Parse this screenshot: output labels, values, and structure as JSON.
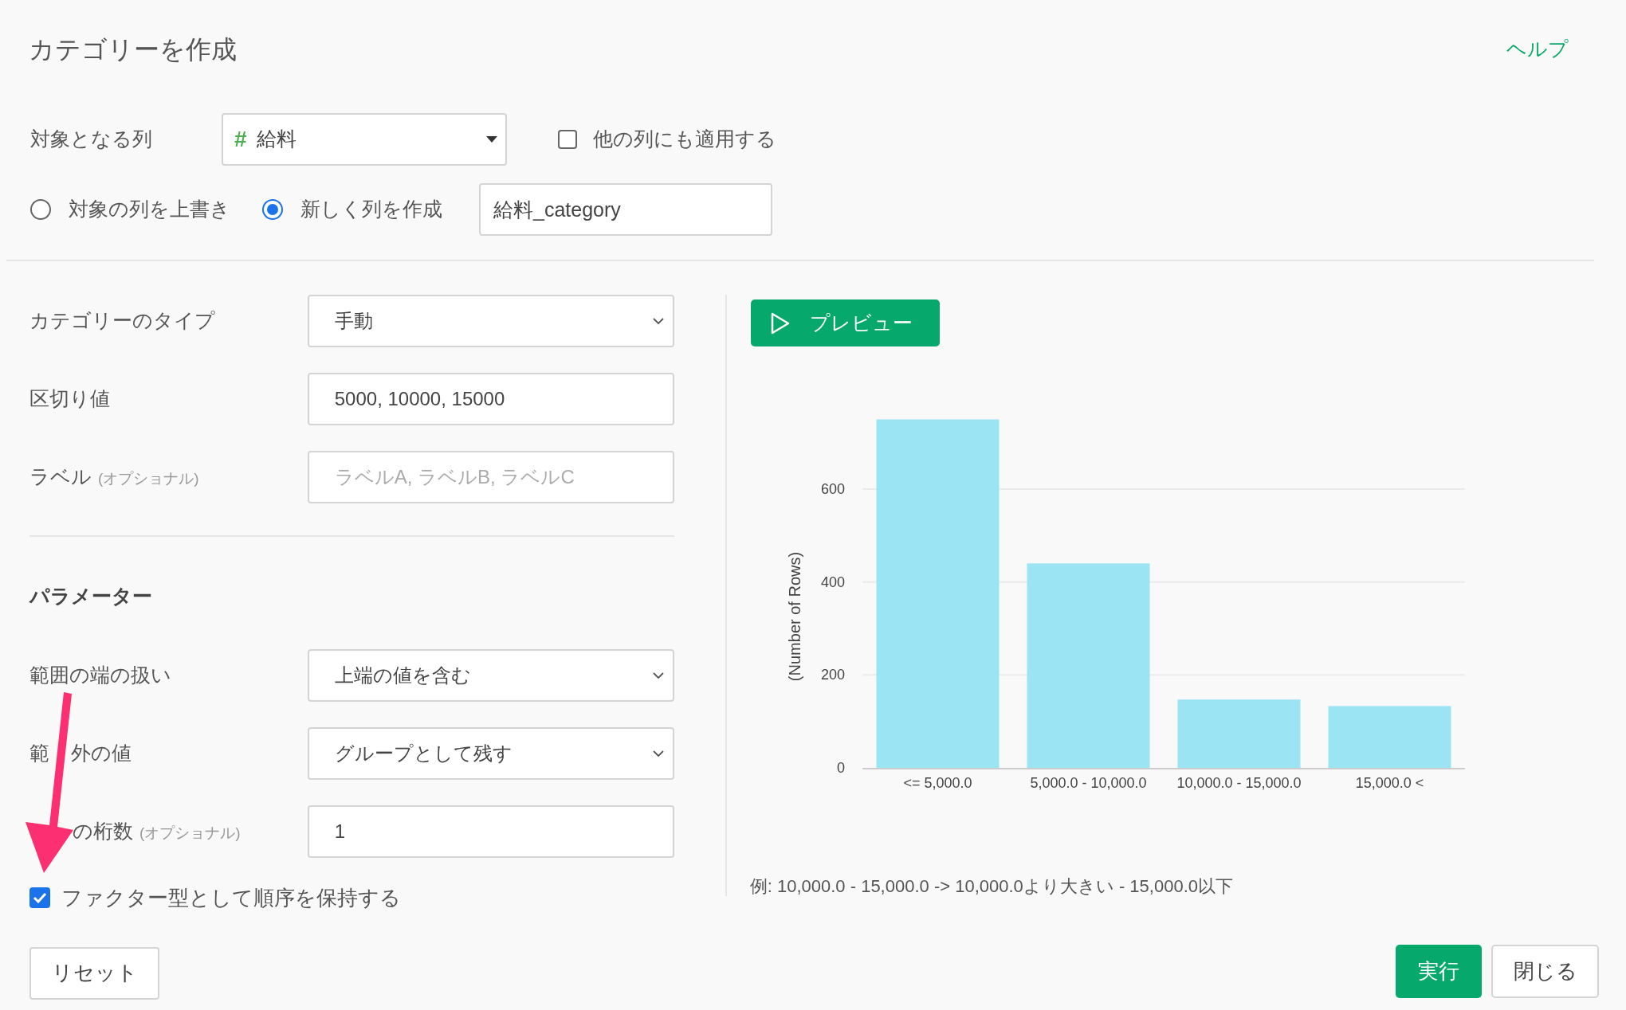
{
  "title": "カテゴリーを作成",
  "help_link": "ヘルプ",
  "target_column": {
    "label": "対象となる列",
    "type_icon": "#",
    "value": "給料"
  },
  "apply_other": {
    "label": "他の列にも適用する",
    "checked": false
  },
  "output_mode": [
    {
      "label": "対象の列を上書き",
      "selected": false
    },
    {
      "label": "新しく列を作成",
      "selected": true
    }
  ],
  "new_column_name": {
    "value": "給料_category"
  },
  "settings": [
    {
      "kind": "select",
      "label": "カテゴリーのタイプ",
      "value": "手動"
    },
    {
      "kind": "input",
      "label": "区切り値",
      "value": "5000, 10000, 15000"
    },
    {
      "kind": "input",
      "label": "ラベル",
      "note": "(オプショナル)",
      "placeholder": "ラベルA, ラベルB, ラベルC"
    }
  ],
  "parameters": {
    "heading": "パラメーター",
    "fields": [
      {
        "kind": "select",
        "label": "範囲の端の扱い",
        "value": "上端の値を含む"
      },
      {
        "kind": "select",
        "label_parts": [
          "範",
          "外の値"
        ],
        "value": "グループとして残す"
      },
      {
        "kind": "input",
        "label_parts": [
          "の桁数"
        ],
        "hidden_lead": true,
        "note": "(オプショナル)",
        "value": "1"
      }
    ]
  },
  "factor_option": {
    "label": "ファクター型として順序を保持する",
    "checked": true
  },
  "preview_button": "プレビュー",
  "chart_data": {
    "type": "bar",
    "ylabel": "(Number of Rows)",
    "categories": [
      "<= 5,000.0",
      "5,000.0 - 10,000.0",
      "10,000.0 - 15,000.0",
      "15,000.0 <"
    ],
    "series": [
      {
        "color": "#9be4f4",
        "values": [
          750,
          440,
          147,
          133
        ]
      }
    ],
    "grid": true,
    "ylim": [
      0,
      750
    ],
    "yticks": [
      0,
      200,
      400,
      600
    ]
  },
  "example": "例: 10,000.0 - 15,000.0 -> 10,000.0より大きい - 15,000.0以下",
  "buttons": {
    "reset": "リセット",
    "run": "実行",
    "close": "閉じる"
  }
}
